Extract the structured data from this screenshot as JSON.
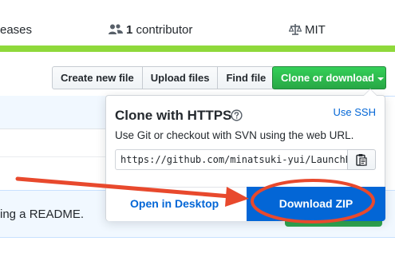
{
  "summary": {
    "releases_label": "eases",
    "contributors_count": "1",
    "contributors_label": " contributor",
    "license_label": "MIT",
    "contributors_icon": "people-icon",
    "license_icon": "law-icon"
  },
  "toolbar": {
    "create_new_file": "Create new file",
    "upload_files": "Upload files",
    "find_file": "Find file",
    "clone_or_download": "Clone or download"
  },
  "clone_popup": {
    "title": "Clone with HTTPS",
    "use_ssh": "Use SSH",
    "description": "Use Git or checkout with SVN using the web URL.",
    "url_value": "https://github.com/minatsuki-yui/LaunchBar",
    "copy_icon": "clipboard-icon",
    "help_icon": "question-icon",
    "open_in_desktop": "Open in Desktop",
    "download_zip": "Download ZIP"
  },
  "readme": {
    "text": "ing a README."
  },
  "colors": {
    "accent_green": "#2ea44f",
    "link_blue": "#0366d6",
    "annotation_red": "#e8492d"
  }
}
